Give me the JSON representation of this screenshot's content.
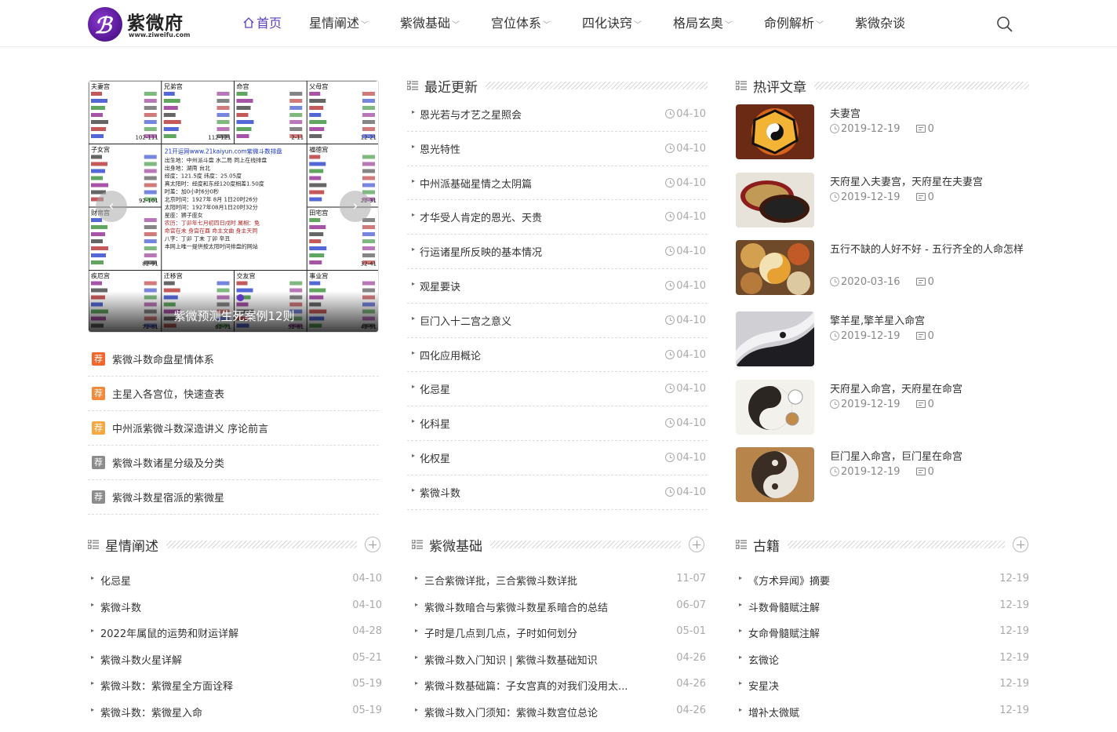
{
  "header": {
    "logo_name": "紫微府",
    "logo_url": "www.ziweifu.com",
    "nav": [
      {
        "label": "首页",
        "active": true,
        "dropdown": false
      },
      {
        "label": "星情阐述",
        "active": false,
        "dropdown": true
      },
      {
        "label": "紫微基础",
        "active": false,
        "dropdown": true
      },
      {
        "label": "宫位体系",
        "active": false,
        "dropdown": true
      },
      {
        "label": "四化诀窍",
        "active": false,
        "dropdown": true
      },
      {
        "label": "格局玄奥",
        "active": false,
        "dropdown": true
      },
      {
        "label": "命例解析",
        "active": false,
        "dropdown": true
      },
      {
        "label": "紫微杂谈",
        "active": false,
        "dropdown": false
      }
    ]
  },
  "slider": {
    "caption": "紫微预测生死案例12则",
    "chart_header": "21开运网www.21kaiyun.com紫微斗数排盘",
    "chart_info": [
      "出生地：中州派斗盘 水二局 同上在线排盘",
      "出身地：湖南 台北",
      "经度：121.5度 纬度：25.05度",
      "真太阳时：经度和东经120度相差1.50度",
      "时差：加0小时6分0秒",
      "北京时间：1927年 8月 1日20时26分",
      "太阳时间：1927年08月1日20时32分",
      "星座：狮子座女",
      "农历：丁卯年七月初四日戌时 属相：兔",
      "命宫在未 身宫在酉 命主文曲 身主天同",
      "八字：丁卯 丁未 丁卯 辛丑",
      "本网上唯一提供按太阳时间排盘的网站"
    ],
    "palaces": [
      "夫妻宫",
      "兄弟宫",
      "命宫",
      "父母宫",
      "子女宫",
      "福德宫",
      "财帛宫",
      "田宅宫",
      "疾厄宫",
      "迁移宫",
      "交友宫",
      "事业宫"
    ],
    "ranges": [
      "102-111",
      "112-121",
      "2-11",
      "12-21",
      "92-101",
      "22-31",
      "82-91",
      "32-41",
      "72-81",
      "62-71",
      "52-61",
      "42-51"
    ]
  },
  "recommend": [
    {
      "badge": "荐",
      "color": "#f2672b",
      "title": "紫微斗数命盘星情体系"
    },
    {
      "badge": "荐",
      "color": "#f28a3a",
      "title": "主星入各宫位，快速查表"
    },
    {
      "badge": "荐",
      "color": "#f5a742",
      "title": "中州派紫微斗数深造讲义 序论前言"
    },
    {
      "badge": "荐",
      "color": "#8c8c8c",
      "title": "紫微斗数诸星分级及分类"
    },
    {
      "badge": "荐",
      "color": "#8c8c8c",
      "title": "紫微斗数星宿派的紫微星"
    }
  ],
  "latest": {
    "title": "最近更新",
    "items": [
      {
        "title": "恩光若与才艺之星照会",
        "date": "04-10"
      },
      {
        "title": "恩光特性",
        "date": "04-10"
      },
      {
        "title": "中州派基础星情之太阴篇",
        "date": "04-10"
      },
      {
        "title": "才华受人肯定的恩光、天贵",
        "date": "04-10"
      },
      {
        "title": "行运诸星所反映的基本情况",
        "date": "04-10"
      },
      {
        "title": "观星要诀",
        "date": "04-10"
      },
      {
        "title": "巨门入十二宫之意义",
        "date": "04-10"
      },
      {
        "title": "四化应用概论",
        "date": "04-10"
      },
      {
        "title": "化忌星",
        "date": "04-10"
      },
      {
        "title": "化科星",
        "date": "04-10"
      },
      {
        "title": "化权星",
        "date": "04-10"
      },
      {
        "title": "紫微斗数",
        "date": "04-10"
      }
    ]
  },
  "hot": {
    "title": "热评文章",
    "items": [
      {
        "title": "夫妻宫",
        "date": "2019-12-19",
        "comments": "0"
      },
      {
        "title": "天府星入夫妻宫，天府星在夫妻宫",
        "date": "2019-12-19",
        "comments": "0"
      },
      {
        "title": "五行不缺的人好不好 - 五行齐全的人命怎样",
        "date": "2020-03-16",
        "comments": "0"
      },
      {
        "title": "擎羊星,擎羊星入命宫",
        "date": "2019-12-19",
        "comments": "0"
      },
      {
        "title": "天府星入命宫，天府星在命宫",
        "date": "2019-12-19",
        "comments": "0"
      },
      {
        "title": "巨门星入命宫，巨门星在命宫",
        "date": "2019-12-19",
        "comments": "0"
      }
    ]
  },
  "columns": [
    {
      "title": "星情阐述",
      "items": [
        {
          "title": "化忌星",
          "date": "04-10"
        },
        {
          "title": "紫微斗数",
          "date": "04-10"
        },
        {
          "title": "2022年属鼠的运势和财运详解",
          "date": "04-28"
        },
        {
          "title": "紫微斗数火星详解",
          "date": "05-21"
        },
        {
          "title": "紫微斗数：紫微星全方面诠释",
          "date": "05-19"
        },
        {
          "title": "紫微斗数：紫微星入命",
          "date": "05-19"
        }
      ]
    },
    {
      "title": "紫微基础",
      "items": [
        {
          "title": "三合紫微详批，三合紫微斗数详批",
          "date": "11-07"
        },
        {
          "title": "紫微斗数暗合与紫微斗数星系暗合的总结",
          "date": "06-07"
        },
        {
          "title": "子时是几点到几点，子时如何划分",
          "date": "05-01"
        },
        {
          "title": "紫微斗数入门知识 | 紫微斗数基础知识",
          "date": "04-26"
        },
        {
          "title": "紫微斗数基础篇：子女宫真的对我们没用太...",
          "date": "04-26"
        },
        {
          "title": "紫微斗数入门须知：紫微斗数宫位总论",
          "date": "04-26"
        }
      ]
    },
    {
      "title": "古籍",
      "items": [
        {
          "title": "《方术异闻》摘要",
          "date": "12-19"
        },
        {
          "title": "斗数骨髓赋注解",
          "date": "12-19"
        },
        {
          "title": "女命骨髓赋注解",
          "date": "12-19"
        },
        {
          "title": "玄微论",
          "date": "12-19"
        },
        {
          "title": "安星决",
          "date": "12-19"
        },
        {
          "title": "增补太微赋",
          "date": "12-19"
        }
      ]
    }
  ]
}
